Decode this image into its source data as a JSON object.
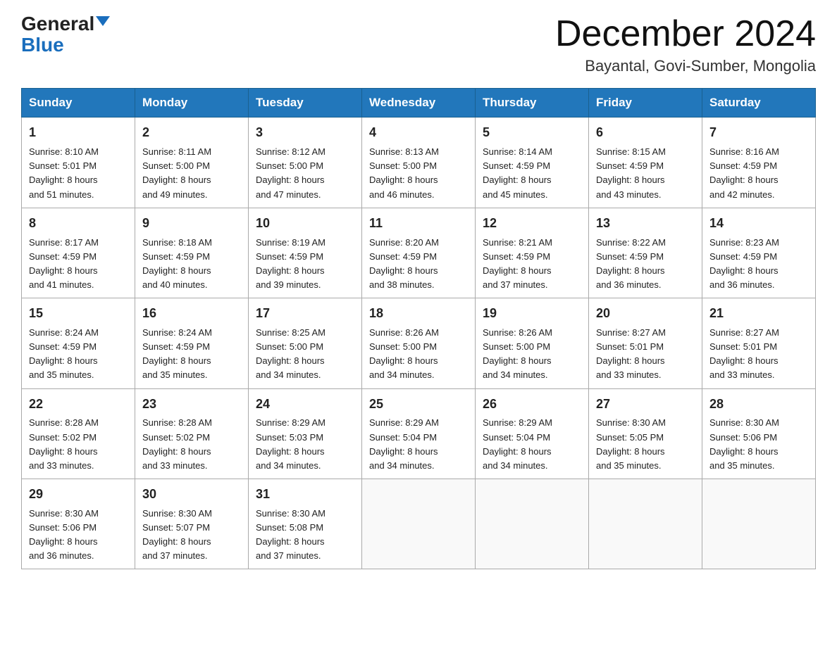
{
  "logo": {
    "line1_black": "General",
    "line1_blue_triangle": "▲",
    "line2": "Blue"
  },
  "header": {
    "month_title": "December 2024",
    "subtitle": "Bayantal, Govi-Sumber, Mongolia"
  },
  "weekdays": [
    "Sunday",
    "Monday",
    "Tuesday",
    "Wednesday",
    "Thursday",
    "Friday",
    "Saturday"
  ],
  "weeks": [
    [
      {
        "day": "1",
        "sunrise": "8:10 AM",
        "sunset": "5:01 PM",
        "daylight": "8 hours and 51 minutes."
      },
      {
        "day": "2",
        "sunrise": "8:11 AM",
        "sunset": "5:00 PM",
        "daylight": "8 hours and 49 minutes."
      },
      {
        "day": "3",
        "sunrise": "8:12 AM",
        "sunset": "5:00 PM",
        "daylight": "8 hours and 47 minutes."
      },
      {
        "day": "4",
        "sunrise": "8:13 AM",
        "sunset": "5:00 PM",
        "daylight": "8 hours and 46 minutes."
      },
      {
        "day": "5",
        "sunrise": "8:14 AM",
        "sunset": "4:59 PM",
        "daylight": "8 hours and 45 minutes."
      },
      {
        "day": "6",
        "sunrise": "8:15 AM",
        "sunset": "4:59 PM",
        "daylight": "8 hours and 43 minutes."
      },
      {
        "day": "7",
        "sunrise": "8:16 AM",
        "sunset": "4:59 PM",
        "daylight": "8 hours and 42 minutes."
      }
    ],
    [
      {
        "day": "8",
        "sunrise": "8:17 AM",
        "sunset": "4:59 PM",
        "daylight": "8 hours and 41 minutes."
      },
      {
        "day": "9",
        "sunrise": "8:18 AM",
        "sunset": "4:59 PM",
        "daylight": "8 hours and 40 minutes."
      },
      {
        "day": "10",
        "sunrise": "8:19 AM",
        "sunset": "4:59 PM",
        "daylight": "8 hours and 39 minutes."
      },
      {
        "day": "11",
        "sunrise": "8:20 AM",
        "sunset": "4:59 PM",
        "daylight": "8 hours and 38 minutes."
      },
      {
        "day": "12",
        "sunrise": "8:21 AM",
        "sunset": "4:59 PM",
        "daylight": "8 hours and 37 minutes."
      },
      {
        "day": "13",
        "sunrise": "8:22 AM",
        "sunset": "4:59 PM",
        "daylight": "8 hours and 36 minutes."
      },
      {
        "day": "14",
        "sunrise": "8:23 AM",
        "sunset": "4:59 PM",
        "daylight": "8 hours and 36 minutes."
      }
    ],
    [
      {
        "day": "15",
        "sunrise": "8:24 AM",
        "sunset": "4:59 PM",
        "daylight": "8 hours and 35 minutes."
      },
      {
        "day": "16",
        "sunrise": "8:24 AM",
        "sunset": "4:59 PM",
        "daylight": "8 hours and 35 minutes."
      },
      {
        "day": "17",
        "sunrise": "8:25 AM",
        "sunset": "5:00 PM",
        "daylight": "8 hours and 34 minutes."
      },
      {
        "day": "18",
        "sunrise": "8:26 AM",
        "sunset": "5:00 PM",
        "daylight": "8 hours and 34 minutes."
      },
      {
        "day": "19",
        "sunrise": "8:26 AM",
        "sunset": "5:00 PM",
        "daylight": "8 hours and 34 minutes."
      },
      {
        "day": "20",
        "sunrise": "8:27 AM",
        "sunset": "5:01 PM",
        "daylight": "8 hours and 33 minutes."
      },
      {
        "day": "21",
        "sunrise": "8:27 AM",
        "sunset": "5:01 PM",
        "daylight": "8 hours and 33 minutes."
      }
    ],
    [
      {
        "day": "22",
        "sunrise": "8:28 AM",
        "sunset": "5:02 PM",
        "daylight": "8 hours and 33 minutes."
      },
      {
        "day": "23",
        "sunrise": "8:28 AM",
        "sunset": "5:02 PM",
        "daylight": "8 hours and 33 minutes."
      },
      {
        "day": "24",
        "sunrise": "8:29 AM",
        "sunset": "5:03 PM",
        "daylight": "8 hours and 34 minutes."
      },
      {
        "day": "25",
        "sunrise": "8:29 AM",
        "sunset": "5:04 PM",
        "daylight": "8 hours and 34 minutes."
      },
      {
        "day": "26",
        "sunrise": "8:29 AM",
        "sunset": "5:04 PM",
        "daylight": "8 hours and 34 minutes."
      },
      {
        "day": "27",
        "sunrise": "8:30 AM",
        "sunset": "5:05 PM",
        "daylight": "8 hours and 35 minutes."
      },
      {
        "day": "28",
        "sunrise": "8:30 AM",
        "sunset": "5:06 PM",
        "daylight": "8 hours and 35 minutes."
      }
    ],
    [
      {
        "day": "29",
        "sunrise": "8:30 AM",
        "sunset": "5:06 PM",
        "daylight": "8 hours and 36 minutes."
      },
      {
        "day": "30",
        "sunrise": "8:30 AM",
        "sunset": "5:07 PM",
        "daylight": "8 hours and 37 minutes."
      },
      {
        "day": "31",
        "sunrise": "8:30 AM",
        "sunset": "5:08 PM",
        "daylight": "8 hours and 37 minutes."
      },
      null,
      null,
      null,
      null
    ]
  ],
  "labels": {
    "sunrise": "Sunrise:",
    "sunset": "Sunset:",
    "daylight": "Daylight:"
  }
}
